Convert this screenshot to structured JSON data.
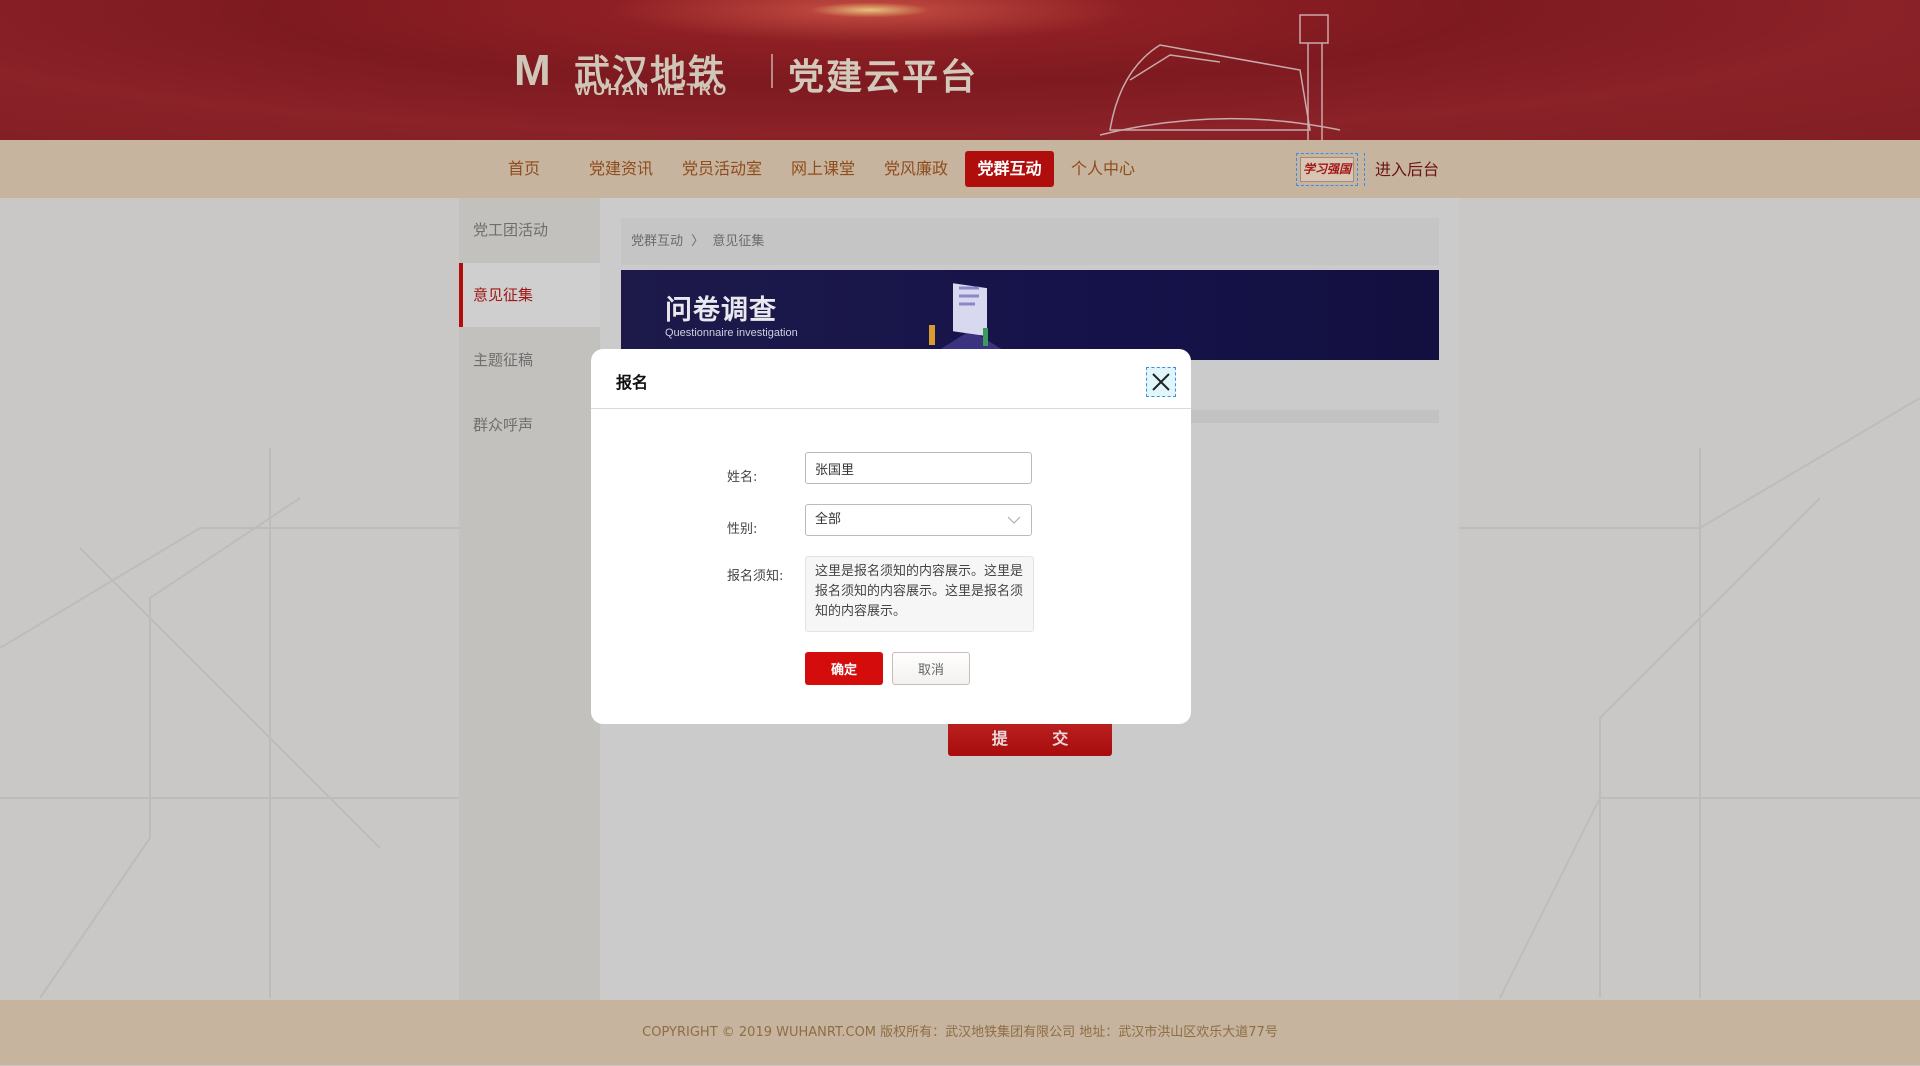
{
  "header": {
    "logo_mark": "M",
    "logo_cn": "武汉地铁",
    "logo_en": "WUHAN METRO",
    "platform_title": "党建云平台"
  },
  "nav": {
    "items": [
      {
        "label": "首页"
      },
      {
        "label": "党建资讯"
      },
      {
        "label": "党员活动室"
      },
      {
        "label": "网上课堂"
      },
      {
        "label": "党风廉政"
      },
      {
        "label": "党群互动",
        "active": true
      },
      {
        "label": "个人中心"
      }
    ],
    "badge_label": "学习强国",
    "backend_label": "进入后台"
  },
  "sidebar": {
    "items": [
      {
        "label": "党工团活动"
      },
      {
        "label": "意见征集",
        "active": true
      },
      {
        "label": "主题征稿"
      },
      {
        "label": "群众呼声"
      }
    ]
  },
  "breadcrumb": {
    "parent": "党群互动",
    "separator": "〉",
    "current": "意见征集"
  },
  "banner": {
    "title": "问卷调查",
    "subtitle": "Questionnaire investigation"
  },
  "submit_label": "提 交",
  "modal": {
    "title": "报名",
    "name_label": "姓名:",
    "name_value": "张国里",
    "gender_label": "性别:",
    "gender_value": "全部",
    "notice_label": "报名须知:",
    "notice_text": "这里是报名须知的内容展示。这里是报名须知的内容展示。这里是报名须知的内容展示。",
    "ok_label": "确定",
    "cancel_label": "取消"
  },
  "footer": {
    "text": "COPYRIGHT © 2019 WUHANRT.COM  版权所有：武汉地铁集团有限公司  地址：武汉市洪山区欢乐大道77号"
  },
  "colors": {
    "brand_red": "#b00d0d",
    "nav_bg": "#c6b49f",
    "banner_bg": "#15124a"
  }
}
